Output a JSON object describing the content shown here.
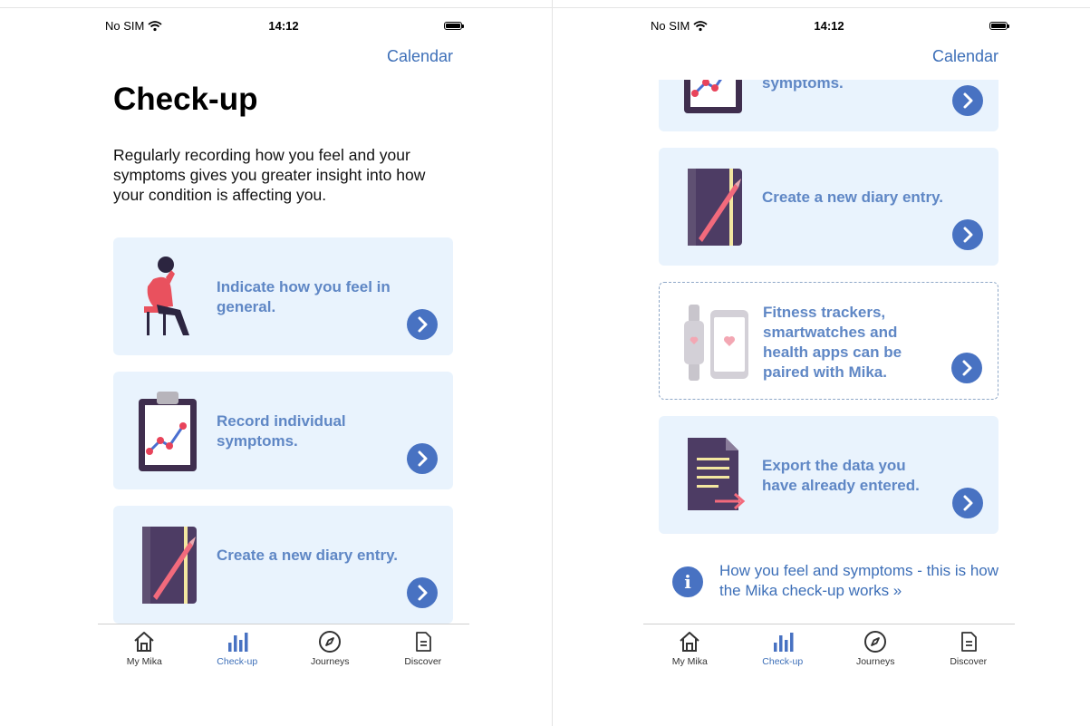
{
  "status_bar": {
    "carrier": "No SIM",
    "time": "14:12"
  },
  "nav": {
    "calendar_label": "Calendar"
  },
  "page": {
    "title": "Check-up",
    "intro": "Regularly recording how you feel and your symptoms gives you greater insight into how your condition is affecting you."
  },
  "cards": {
    "feel": {
      "label": "Indicate how you feel in general."
    },
    "symptoms": {
      "label": "Record individual symptoms."
    },
    "diary": {
      "label": "Create a new diary entry."
    },
    "fitness": {
      "label": "Fitness trackers, smartwatches and health apps can be paired with Mika."
    },
    "export": {
      "label": "Export the data you have already entered."
    }
  },
  "info_link": {
    "text": "How you feel and symptoms - this is how the Mika check-up works »"
  },
  "tabs": {
    "my_mika": "My Mika",
    "checkup": "Check-up",
    "journeys": "Journeys",
    "discover": "Discover"
  },
  "colors": {
    "accent": "#3d6fb8",
    "card_bg": "#e9f3fd",
    "button": "#4872c2",
    "label": "#5f87c5"
  }
}
